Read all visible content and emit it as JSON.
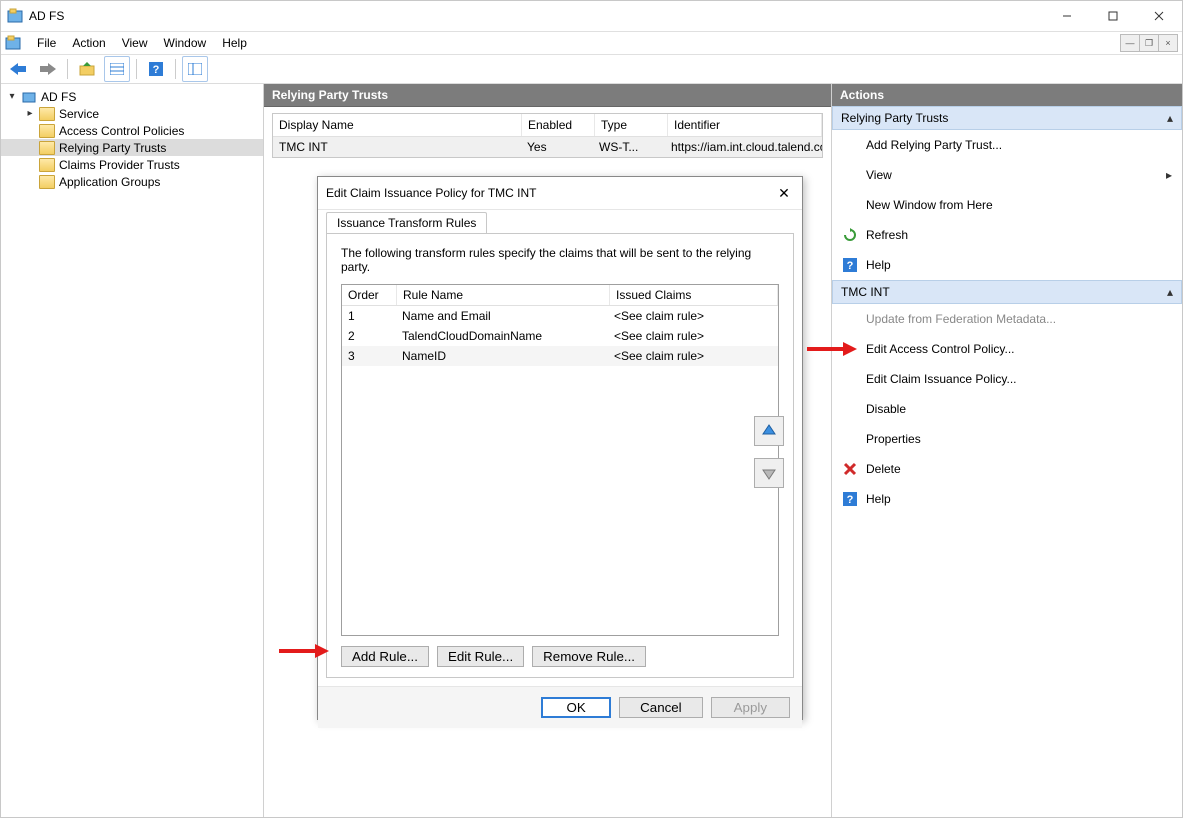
{
  "window": {
    "title": "AD FS"
  },
  "menus": {
    "file": "File",
    "action": "Action",
    "view": "View",
    "window": "Window",
    "help": "Help"
  },
  "tree": {
    "root": "AD FS",
    "items": [
      {
        "label": "Service",
        "expandable": true
      },
      {
        "label": "Access Control Policies",
        "expandable": false
      },
      {
        "label": "Relying Party Trusts",
        "expandable": false,
        "selected": true
      },
      {
        "label": "Claims Provider Trusts",
        "expandable": false
      },
      {
        "label": "Application Groups",
        "expandable": false
      }
    ]
  },
  "center": {
    "header": "Relying Party Trusts",
    "columns": {
      "display_name": "Display Name",
      "enabled": "Enabled",
      "type": "Type",
      "identifier": "Identifier"
    },
    "rows": [
      {
        "display_name": "TMC INT",
        "enabled": "Yes",
        "type": "WS-T...",
        "identifier": "https://iam.int.cloud.talend.com"
      }
    ]
  },
  "actions": {
    "header": "Actions",
    "section1": {
      "title": "Relying Party Trusts",
      "items": [
        {
          "label": "Add Relying Party Trust..."
        },
        {
          "label": "View",
          "submenu": true
        },
        {
          "label": "New Window from Here"
        },
        {
          "label": "Refresh",
          "icon": "refresh"
        },
        {
          "label": "Help",
          "icon": "help"
        }
      ]
    },
    "section2": {
      "title": "TMC INT",
      "items": [
        {
          "label": "Update from Federation Metadata...",
          "disabled": true
        },
        {
          "label": "Edit Access Control Policy..."
        },
        {
          "label": "Edit Claim Issuance Policy..."
        },
        {
          "label": "Disable"
        },
        {
          "label": "Properties"
        },
        {
          "label": "Delete",
          "icon": "delete"
        },
        {
          "label": "Help",
          "icon": "help"
        }
      ]
    }
  },
  "dialog": {
    "title": "Edit Claim Issuance Policy for TMC INT",
    "tab": "Issuance Transform Rules",
    "desc": "The following transform rules specify the claims that will be sent to the relying party.",
    "columns": {
      "order": "Order",
      "rule_name": "Rule Name",
      "issued": "Issued Claims"
    },
    "rules": [
      {
        "order": "1",
        "name": "Name and Email",
        "issued": "<See claim rule>"
      },
      {
        "order": "2",
        "name": "TalendCloudDomainName",
        "issued": "<See claim rule>"
      },
      {
        "order": "3",
        "name": "NameID",
        "issued": "<See claim rule>"
      }
    ],
    "buttons": {
      "add": "Add Rule...",
      "edit": "Edit Rule...",
      "remove": "Remove Rule...",
      "ok": "OK",
      "cancel": "Cancel",
      "apply": "Apply"
    }
  }
}
